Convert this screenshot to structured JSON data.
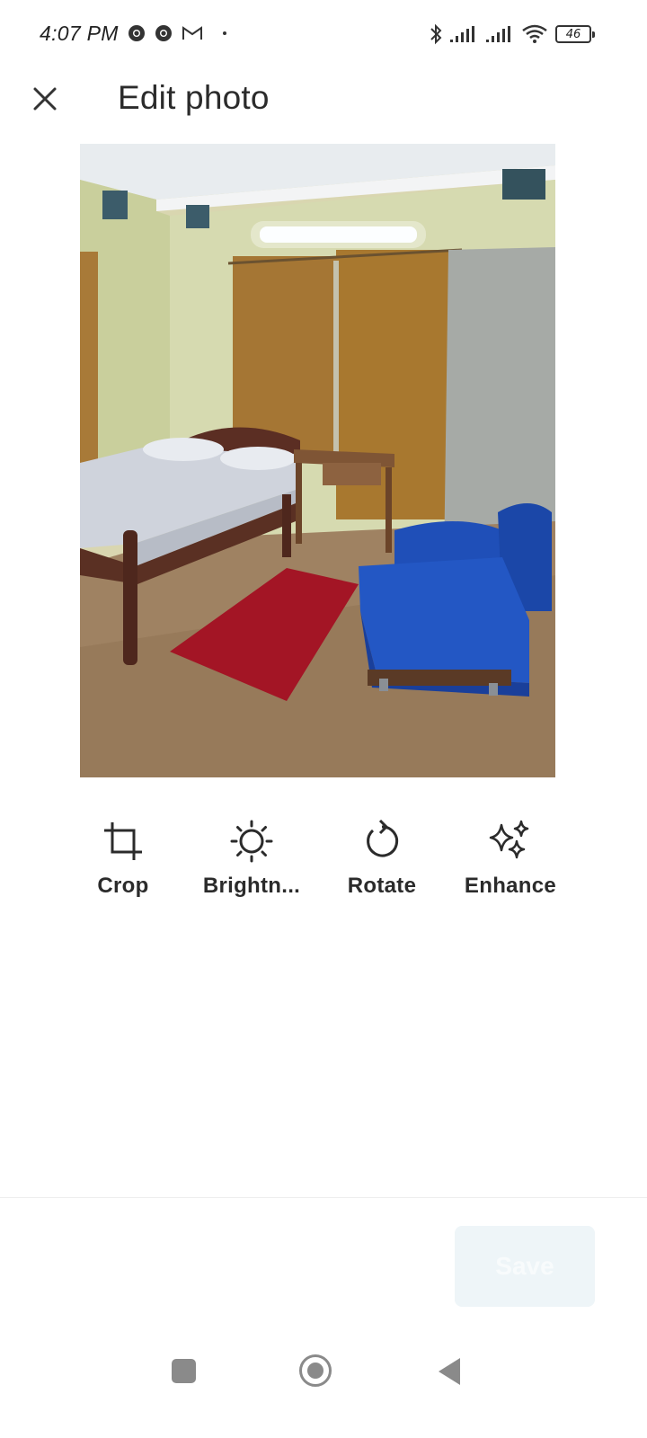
{
  "status_bar": {
    "time": "4:07 PM",
    "battery_level": "46",
    "left_icons": [
      "chrome-icon",
      "chrome-icon",
      "gmail-icon",
      "notification-dot"
    ],
    "right_icons": [
      "bluetooth-icon",
      "signal-icon",
      "signal-icon",
      "wifi-icon",
      "battery-icon"
    ]
  },
  "app_bar": {
    "close_icon": "close-icon",
    "title": "Edit photo"
  },
  "photo": {
    "subject": "bedroom-photo"
  },
  "tools": [
    {
      "label": "Crop",
      "icon": "crop-icon"
    },
    {
      "label": "Brightn...",
      "icon": "brightness-icon"
    },
    {
      "label": "Rotate",
      "icon": "rotate-icon"
    },
    {
      "label": "Enhance",
      "icon": "sparkle-icon"
    }
  ],
  "footer": {
    "save_label": "Save",
    "save_enabled": false
  },
  "nav_bar": {
    "recents_icon": "recents-icon",
    "home_icon": "home-icon",
    "back_icon": "back-icon"
  },
  "colors": {
    "text": "#2b2b2b",
    "save_bg_disabled": "#eef5f8",
    "nav_icons": "#8a8a8a"
  }
}
